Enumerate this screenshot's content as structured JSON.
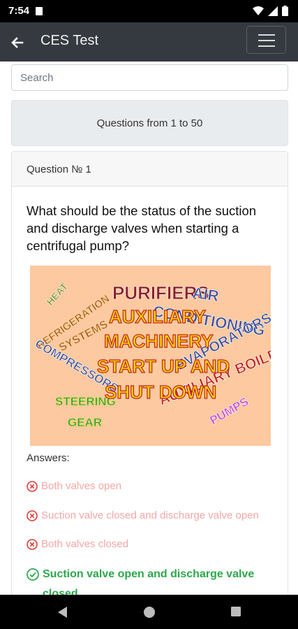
{
  "status_bar": {
    "time": "7:54"
  },
  "app_bar": {
    "title": "CES Test"
  },
  "search": {
    "placeholder": "Search"
  },
  "range": {
    "label": "Questions from 1 to 50"
  },
  "question": {
    "header": "Question № 1",
    "text": "What should be the status of the suction and discharge valves when starting a centrifugal pump?",
    "image_words": {
      "main": [
        "AUXILIARY",
        "MACHINERY",
        "START UP AND",
        "SHUT DOWN"
      ],
      "background": [
        "PURIFIERS",
        "AIR",
        "CONDITIONING",
        "REFRIGERATION",
        "HEAT",
        "SYSTEMS",
        "COMPRESSORS",
        "EVAPORATORS",
        "AUXILIARY BOILERS",
        "PUMPS",
        "STEERING",
        "GEAR"
      ]
    }
  },
  "answers": {
    "label": "Answers:",
    "items": [
      {
        "text": "Both valves open",
        "correct": false
      },
      {
        "text": "Suction valve closed and discharge valve open",
        "correct": false
      },
      {
        "text": "Both valves closed",
        "correct": false
      },
      {
        "text": "Suction valve open and discharge valve closed",
        "correct": true
      }
    ]
  },
  "colors": {
    "app_bar": "#343a40",
    "wrong": "#f2a7a5",
    "correct": "#2ba84a",
    "image_bg": "#fcc9a0"
  }
}
